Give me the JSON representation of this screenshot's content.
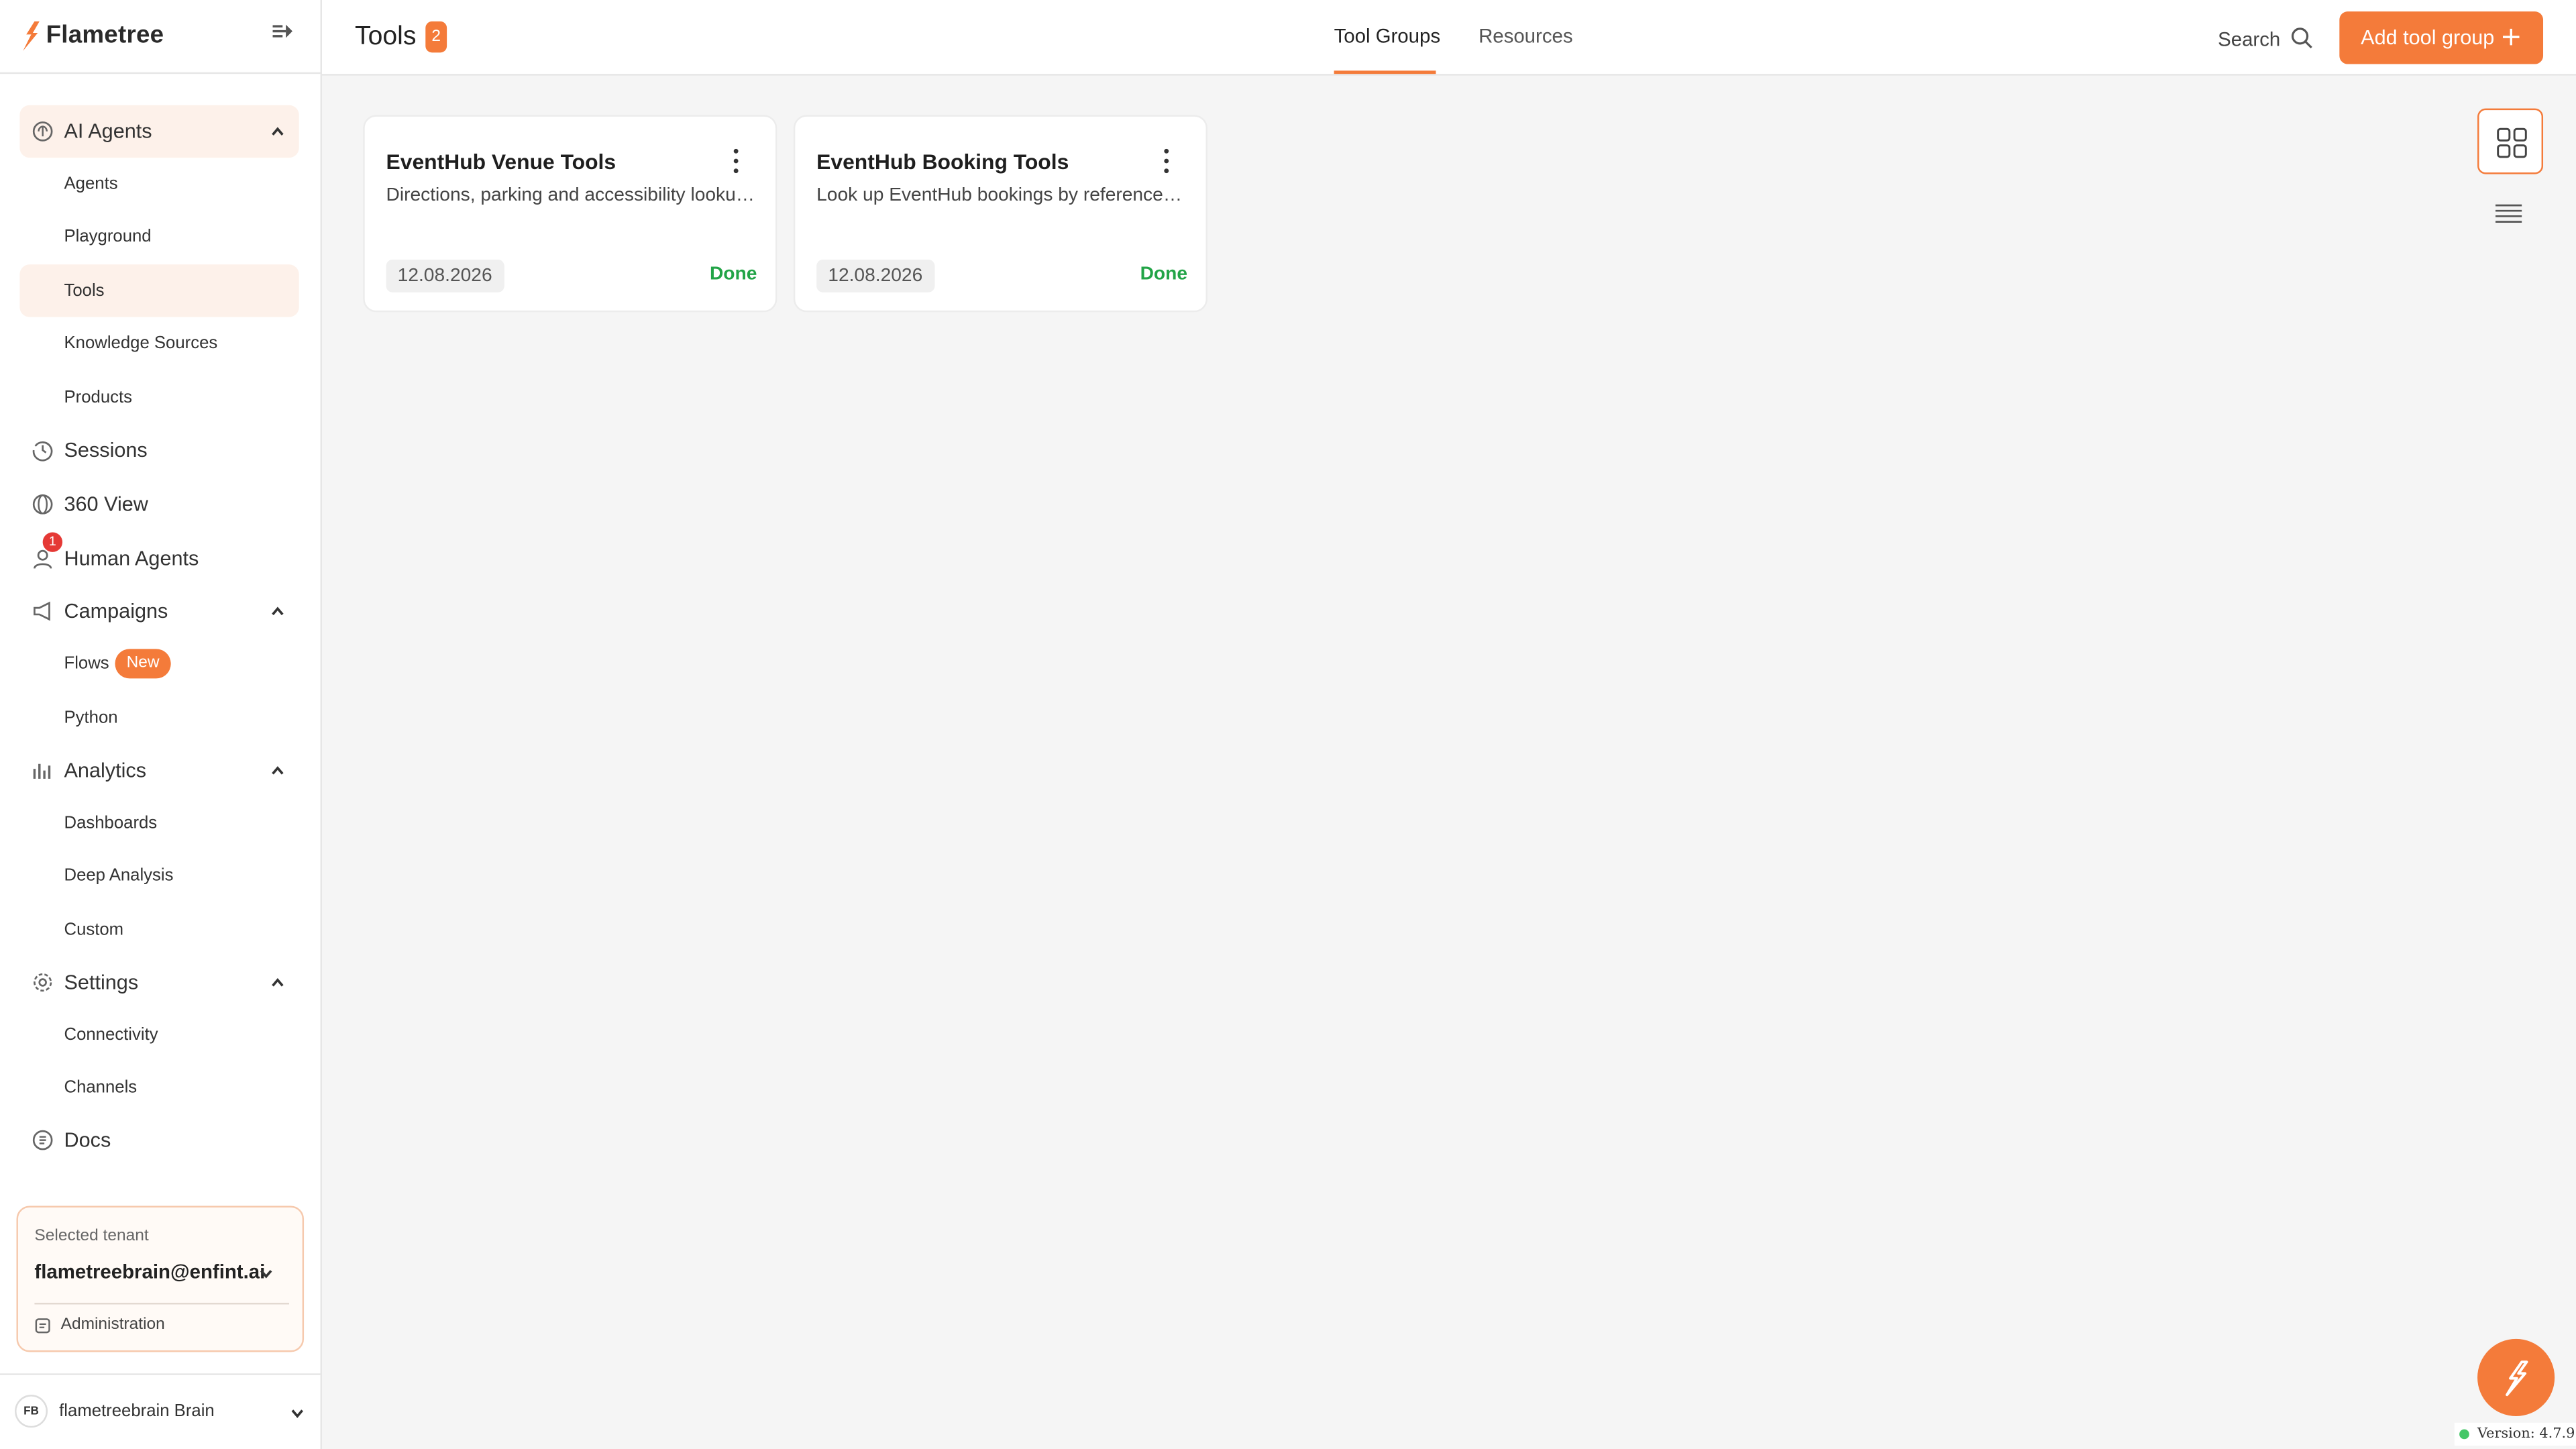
{
  "brand": {
    "name": "Flametree"
  },
  "colors": {
    "accent": "#f47b3a",
    "done": "#22a447",
    "notif": "#e53935"
  },
  "sidebar": {
    "ai_agents": {
      "label": "AI Agents",
      "children": [
        "Agents",
        "Playground",
        "Tools",
        "Knowledge Sources",
        "Products"
      ]
    },
    "sessions": "Sessions",
    "view360": "360 View",
    "human_agents": {
      "label": "Human Agents",
      "notifications": "1"
    },
    "campaigns": {
      "label": "Campaigns",
      "flows": "Flows",
      "flows_badge": "New",
      "python": "Python"
    },
    "analytics": {
      "label": "Analytics",
      "children": [
        "Dashboards",
        "Deep Analysis",
        "Custom"
      ]
    },
    "settings": {
      "label": "Settings",
      "children": [
        "Connectivity",
        "Channels"
      ]
    },
    "docs": "Docs",
    "tenant": {
      "caption": "Selected tenant",
      "value": "flametreebrain@enfint.ai",
      "admin": "Administration"
    },
    "user": {
      "initials": "FB",
      "name": "flametreebrain Brain"
    }
  },
  "header": {
    "title": "Tools",
    "count": "2",
    "tabs": [
      {
        "label": "Tool Groups",
        "active": true
      },
      {
        "label": "Resources",
        "active": false
      }
    ],
    "search_label": "Search",
    "add_button": "Add tool group"
  },
  "cards": [
    {
      "title": "EventHub Venue Tools",
      "description": "Directions, parking and accessibility lookups for EventHub venues",
      "date": "12.08.2026",
      "status": "Done"
    },
    {
      "title": "EventHub Booking Tools",
      "description": "Look up EventHub bookings by reference number",
      "date": "12.08.2026",
      "status": "Done"
    }
  ],
  "version": "Version: 4.7.9"
}
